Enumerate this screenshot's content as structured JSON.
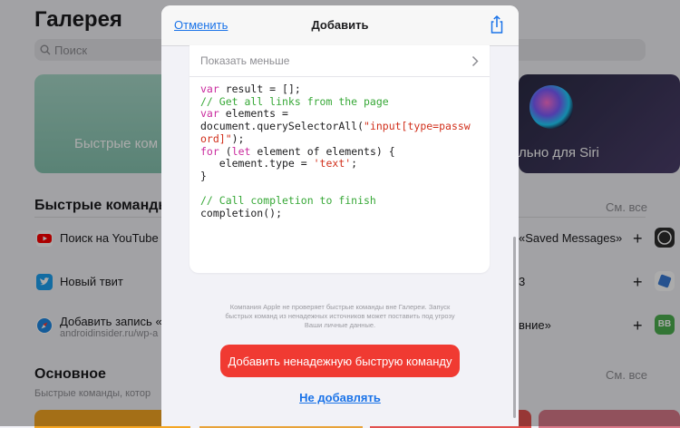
{
  "background": {
    "title": "Галерея",
    "search_placeholder": "Поиск",
    "cards": [
      {
        "label": "Быстрые ком"
      },
      {
        "label": "льно для Siri"
      }
    ],
    "section1": {
      "title": "Быстрые команды",
      "see_all": "См. все",
      "rows_left": [
        {
          "label": "Поиск на YouTube",
          "icon": "youtube-icon"
        },
        {
          "label": "Новый твит",
          "icon": "twitter-icon"
        },
        {
          "label": "Добавить запись «",
          "sub": "androidinsider.ru/wp-a",
          "icon": "safari-icon"
        }
      ],
      "rows_right": [
        {
          "label": "«Saved Messages»",
          "plus": "+"
        },
        {
          "label": "3",
          "plus": "+"
        },
        {
          "label": "вние»",
          "plus": "+"
        }
      ],
      "right_badge": "BB"
    },
    "section2": {
      "title": "Основное",
      "subtitle": "Быстрые команды, котор",
      "see_all": "См. все"
    }
  },
  "modal": {
    "cancel_label": "Отменить",
    "title": "Добавить",
    "show_less_label": "Показать меньше",
    "warning_text": "Компания Apple не проверяет быстрые команды вне Галереи. Запуск быстрых команд из ненадежных источников может поставить под угрозу Ваши личные данные.",
    "add_button_label": "Добавить ненадежную быструю команду",
    "dont_add_label": "Не добавлять"
  },
  "code": {
    "l1_kw": "var",
    "l1_rest": " result = [];",
    "l2_cm": "// Get all links from the page",
    "l3_kw": "var",
    "l3_rest": " elements =",
    "l4_a": "document.querySelectorAll(",
    "l4_str": "\"input[type=passw",
    "l5_str": "ord]\"",
    "l5_rest": ");",
    "l6_kw1": "for",
    "l6_a": " (",
    "l6_kw2": "let",
    "l6_b": " element of elements) {",
    "l7_a": "   element.type = ",
    "l7_str": "'text'",
    "l7_b": ";",
    "l8": "}",
    "l10_cm": "// Call completion to finish",
    "l11": "completion();"
  },
  "colors": {
    "accent_blue": "#1a73e8",
    "danger_red": "#f03a32",
    "code_keyword": "#c92a9d",
    "code_comment": "#37a837",
    "code_string": "#d12f1b"
  }
}
